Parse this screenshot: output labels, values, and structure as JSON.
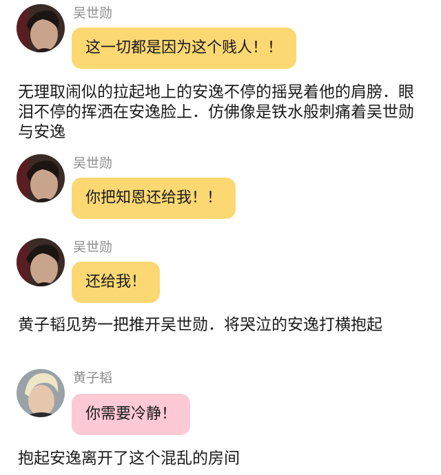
{
  "chat": {
    "m1": {
      "sender": "吴世勋",
      "text": "这一切都是因为这个贱人！！",
      "avatar": "sehun-avatar",
      "bubble_color": "#fcd873"
    },
    "n1": {
      "text": "无理取闹似的拉起地上的安逸不停的摇晃着他的肩膀．眼泪不停的挥洒在安逸脸上．仿佛像是铁水般刺痛着吴世勋与安逸"
    },
    "m2": {
      "sender": "吴世勋",
      "text": "你把知恩还给我！！",
      "avatar": "sehun-avatar",
      "bubble_color": "#fcd873"
    },
    "m3": {
      "sender": "吴世勋",
      "text": "还给我！",
      "avatar": "sehun-avatar",
      "bubble_color": "#fcd873"
    },
    "n2": {
      "text": "黄子韬见势一把推开吴世勋．将哭泣的安逸打横抱起"
    },
    "m4": {
      "sender": "黄子韬",
      "text": "你需要冷静！",
      "avatar": "tao-avatar",
      "bubble_color": "#fcc9d4"
    },
    "n3": {
      "text": "抱起安逸离开了这个混乱的房间"
    }
  }
}
